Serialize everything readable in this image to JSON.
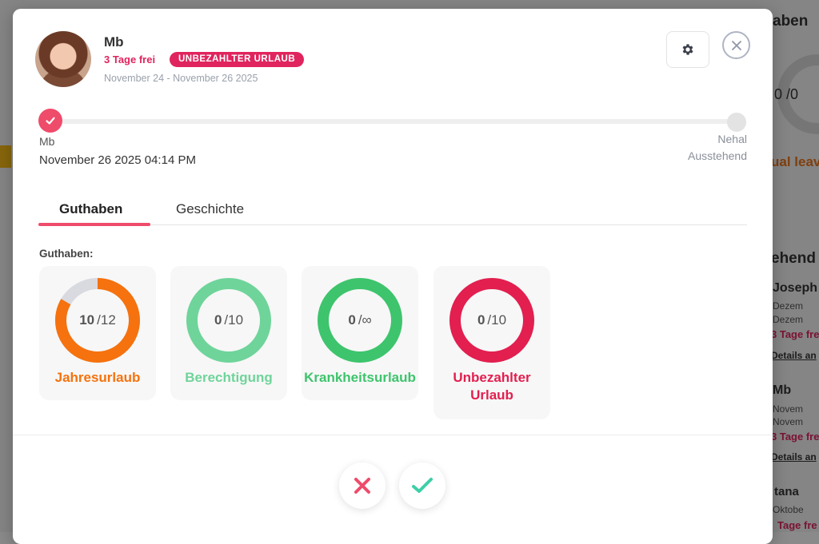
{
  "background": {
    "header_fragment": "aben",
    "ring_value": "0 /0",
    "leave_fragment": "ual leav",
    "pending_fragment": "ehend",
    "entries": [
      {
        "name": "Joseph",
        "dates": [
          "Dezem",
          "Dezem"
        ],
        "days": "3 Tage fre",
        "link": "Details an"
      },
      {
        "name": "Mb",
        "dates": [
          "Novem",
          "Novem"
        ],
        "days": "3 Tage fre",
        "link": "Details an"
      },
      {
        "name": "tana",
        "dates": [
          "Oktobe"
        ],
        "days": "Tage fre",
        "link": ""
      }
    ]
  },
  "request": {
    "user_name": "Mb",
    "days_free": "3 Tage frei",
    "leave_type_badge": "UNBEZAHLTER URLAUB",
    "date_range": "November 24 - November 26 2025"
  },
  "timeline": {
    "completed_step": {
      "name": "Mb",
      "datetime": "November 26 2025 04:14 PM"
    },
    "pending_step": {
      "name": "Nehal",
      "status": "Ausstehend"
    }
  },
  "tabs": [
    {
      "label": "Guthaben",
      "active": true
    },
    {
      "label": "Geschichte",
      "active": false
    }
  ],
  "balances": {
    "section_label": "Guthaben:",
    "items": [
      {
        "used": "10",
        "total": "/12",
        "label": "Jahresurlaub",
        "color": "#f5720e",
        "fraction": 0.8333
      },
      {
        "used": "0",
        "total": "/10",
        "label": "Berechtigung",
        "color": "#6fd49a",
        "fraction": 0
      },
      {
        "used": "0",
        "total": "/∞",
        "label": "Krankheitsurlaub",
        "color": "#3ec46d",
        "fraction": 0
      },
      {
        "used": "0",
        "total": "/10",
        "label": "Unbezahlter Urlaub",
        "color": "#e21f4f",
        "fraction": 0
      }
    ]
  },
  "actions": {
    "reject_icon": "x-icon",
    "approve_icon": "check-icon",
    "reject_color": "#ef4b6a",
    "approve_color": "#3ecfa8"
  }
}
